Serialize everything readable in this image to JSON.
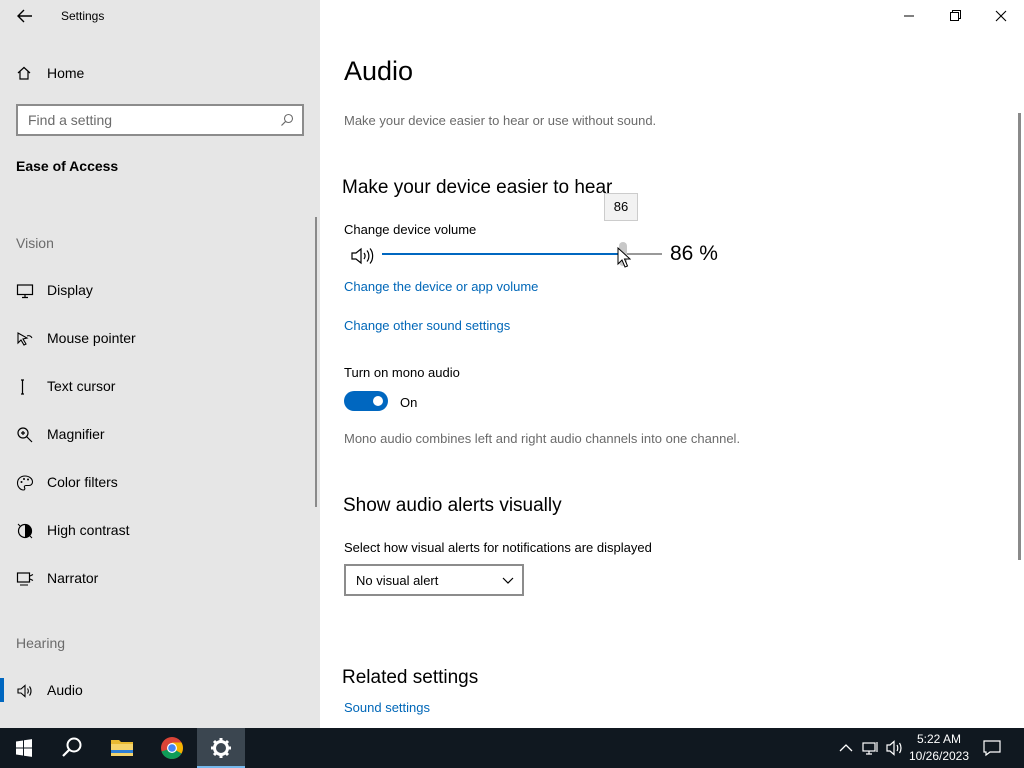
{
  "window": {
    "title": "Settings"
  },
  "sidebar": {
    "home_label": "Home",
    "search_placeholder": "Find a setting",
    "section_title": "Ease of Access",
    "groups": [
      {
        "label": "Vision",
        "items": [
          {
            "label": "Display",
            "icon": "display-icon"
          },
          {
            "label": "Mouse pointer",
            "icon": "mouse-pointer-icon"
          },
          {
            "label": "Text cursor",
            "icon": "text-cursor-icon"
          },
          {
            "label": "Magnifier",
            "icon": "magnifier-icon"
          },
          {
            "label": "Color filters",
            "icon": "color-filters-icon"
          },
          {
            "label": "High contrast",
            "icon": "high-contrast-icon"
          },
          {
            "label": "Narrator",
            "icon": "narrator-icon"
          }
        ]
      },
      {
        "label": "Hearing",
        "items": [
          {
            "label": "Audio",
            "icon": "audio-icon",
            "active": true
          }
        ]
      }
    ]
  },
  "main": {
    "title": "Audio",
    "subtitle": "Make your device easier to hear or use without sound.",
    "section1": {
      "heading": "Make your device easier to hear",
      "volume_label": "Change device volume",
      "volume_value": 86,
      "volume_tooltip": "86",
      "volume_readout": "86 %",
      "link_app_volume": "Change the device or app volume",
      "link_other_sound": "Change other sound settings",
      "mono_label": "Turn on mono audio",
      "mono_state": "On",
      "mono_on": true,
      "mono_description": "Mono audio combines left and right audio channels into one channel."
    },
    "section2": {
      "heading": "Show audio alerts visually",
      "select_label": "Select how visual alerts for notifications are displayed",
      "select_value": "No visual alert"
    },
    "related": {
      "heading": "Related settings",
      "link_sound": "Sound settings"
    }
  },
  "taskbar": {
    "time": "5:22 AM",
    "date": "10/26/2023"
  },
  "colors": {
    "accent": "#0067c0",
    "link": "#0067b8",
    "sidebar_bg": "#e6e6e6",
    "taskbar_bg": "#101820"
  }
}
